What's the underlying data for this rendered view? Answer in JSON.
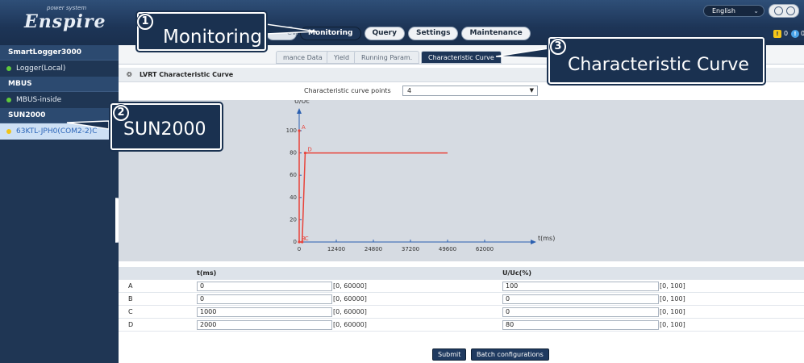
{
  "header": {
    "brand_sub": "power system",
    "brand": "Enspire",
    "nav_tabs": [
      "Monitoring",
      "Query",
      "Settings",
      "Maintenance"
    ],
    "faded_tab": "ew",
    "language": "English",
    "alarm_counts": [
      "0",
      "0"
    ]
  },
  "sidebar": {
    "items": [
      {
        "label": "SmartLogger3000",
        "kind": "title"
      },
      {
        "label": "Logger(Local)",
        "kind": "item"
      },
      {
        "label": "MBUS",
        "kind": "title"
      },
      {
        "label": "MBUS-inside",
        "kind": "item"
      },
      {
        "label": "SUN2000",
        "kind": "title"
      },
      {
        "label": "63KTL-JPH0(COM2-2)C",
        "kind": "selected"
      }
    ]
  },
  "subtabs": [
    "mance Data",
    "Yield",
    "Running Param.",
    "Characteristic Curve"
  ],
  "section": {
    "title": "LVRT Characteristic Curve"
  },
  "points": {
    "label": "Characteristic curve points",
    "value": "4"
  },
  "chart_data": {
    "type": "line",
    "title": "",
    "xlabel": "t(ms)",
    "ylabel": "U/Uc",
    "xlim": [
      0,
      62000
    ],
    "ylim": [
      0,
      100
    ],
    "x_ticks": [
      "0",
      "12400",
      "24800",
      "37200",
      "49600",
      "62000"
    ],
    "y_ticks": [
      "0",
      "20",
      "40",
      "60",
      "80",
      "100"
    ],
    "series": [
      {
        "points": [
          {
            "label": "A",
            "x": 0,
            "y": 100
          },
          {
            "label": "B",
            "x": 0,
            "y": 0
          },
          {
            "label": "C",
            "x": 1000,
            "y": 0
          },
          {
            "label": "D",
            "x": 2000,
            "y": 80
          }
        ],
        "extend_to_x": 49600,
        "color": "#e8433a"
      }
    ]
  },
  "table": {
    "headers": [
      "t(ms)",
      "U/Uc(%)"
    ],
    "rows": [
      {
        "label": "A",
        "t": "0",
        "t_range": "[0, 60000]",
        "u": "100",
        "u_range": "[0, 100]"
      },
      {
        "label": "B",
        "t": "0",
        "t_range": "[0, 60000]",
        "u": "0",
        "u_range": "[0, 100]"
      },
      {
        "label": "C",
        "t": "1000",
        "t_range": "[0, 60000]",
        "u": "0",
        "u_range": "[0, 100]"
      },
      {
        "label": "D",
        "t": "2000",
        "t_range": "[0, 60000]",
        "u": "80",
        "u_range": "[0, 100]"
      }
    ]
  },
  "buttons": {
    "submit": "Submit",
    "batch": "Batch configurations"
  },
  "callouts": [
    {
      "number": "1",
      "text": "Monitoring"
    },
    {
      "number": "2",
      "text": "SUN2000"
    },
    {
      "number": "3",
      "text": "Characteristic Curve"
    }
  ],
  "colors": {
    "nav_dark": "#1d3557",
    "curve": "#e8433a",
    "axis": "#2a5fb0",
    "chart_bg": "#d6dbe2"
  }
}
